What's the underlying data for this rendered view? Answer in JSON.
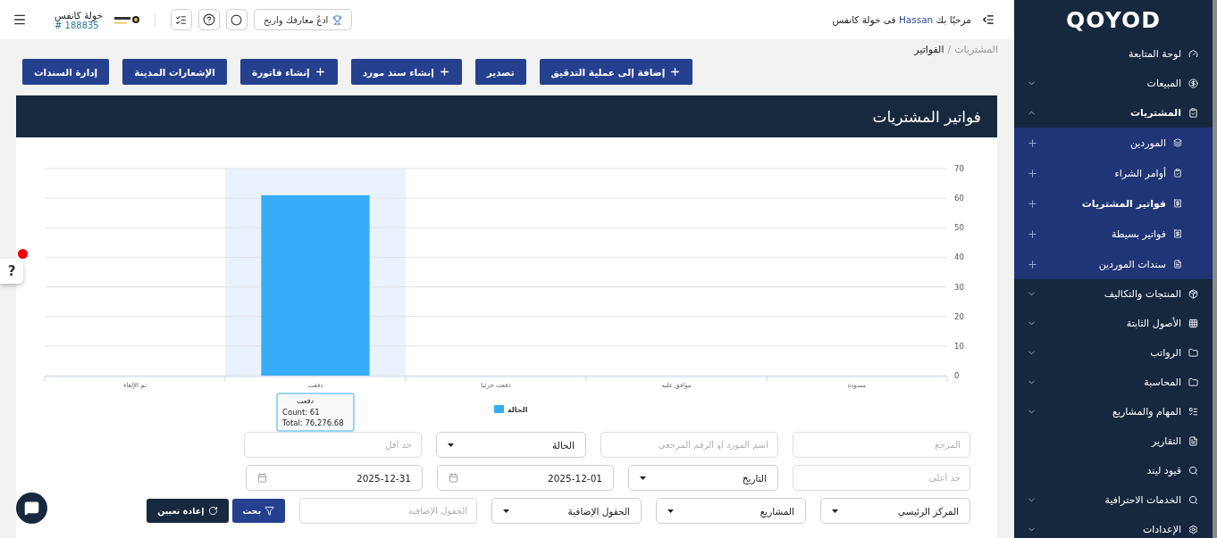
{
  "topbar": {
    "greeting": {
      "prefix": "مرحبًا بك",
      "name": "Hassan",
      "suffix": "فى خولة كانفس"
    },
    "invite": "ادعُ معارفك واربح",
    "company": {
      "name": "خولة كانفس",
      "number": "# 188835"
    }
  },
  "breadcrumb": {
    "separator": "/",
    "items": [
      {
        "label": "المشتريات",
        "current": false
      },
      {
        "label": "الفواتير",
        "current": true
      }
    ]
  },
  "actions": [
    {
      "label": "إضافة إلى عملية التدقيق",
      "kind": "add"
    },
    {
      "label": "تصدير",
      "kind": "plain"
    },
    {
      "label": "إنشاء سند مورد",
      "kind": "add"
    },
    {
      "label": "إنشاء فاتورة",
      "kind": "add"
    },
    {
      "label": "الإشعارات المدينة",
      "kind": "plain"
    },
    {
      "label": "إدارة السندات",
      "kind": "plain"
    }
  ],
  "card": {
    "title": "فواتير المشتريات",
    "chart_data": {
      "type": "bar",
      "categories": [
        "تم الإلغاء",
        "دفعت",
        "دفعت جزئيا",
        "موافق عليه",
        "مسودة"
      ],
      "series": [
        {
          "name": "الحالة",
          "color": "#36adf6",
          "values": [
            0,
            61,
            0,
            0,
            0
          ]
        }
      ],
      "ylim": [
        0,
        70
      ],
      "yticks": [
        0,
        10,
        20,
        30,
        40,
        50,
        60,
        70
      ],
      "grid": true
    },
    "tooltip": {
      "title": "دفعت",
      "lines": [
        "Count: 61",
        "Total: 76,276.68"
      ]
    }
  },
  "filters": {
    "rows": [
      {
        "fields": [
          {
            "kind": "text",
            "placeholder": "المرجع"
          },
          {
            "kind": "text",
            "placeholder": "اسم المورد او الرقم المرجعي"
          },
          {
            "kind": "select",
            "value": "الحالة"
          },
          {
            "kind": "text",
            "placeholder": "حد أقل"
          }
        ]
      },
      {
        "fields": [
          {
            "kind": "text",
            "placeholder": "حد أعلى"
          },
          {
            "kind": "select",
            "value": "التاريخ"
          },
          {
            "kind": "date",
            "value": "2025-12-01"
          },
          {
            "kind": "date",
            "value": "2025-12-31"
          }
        ]
      },
      {
        "fields": [
          {
            "kind": "select",
            "value": "المركز الرئيسي"
          },
          {
            "kind": "select",
            "value": "المشاريع"
          },
          {
            "kind": "select",
            "value": "الحقول الإضافية"
          },
          {
            "kind": "text",
            "placeholder": "الحقول الإضافية"
          }
        ]
      }
    ],
    "search_button": "بحث",
    "reset_button": "إعادة تعيين"
  },
  "help_tab": "?",
  "sidebar": {
    "logo": "QOYOD",
    "items": [
      {
        "label": "لوحة المتابعة",
        "kind": "link",
        "selected": false
      },
      {
        "label": "المبيعات",
        "kind": "group",
        "selected": false,
        "expanded": false
      },
      {
        "label": "المشتريات",
        "kind": "group",
        "selected": false,
        "expanded": true,
        "children": [
          {
            "label": "الموردين",
            "selected": false
          },
          {
            "label": "أوامر الشراء",
            "selected": false
          },
          {
            "label": "فواتير المشتريات",
            "selected": true
          },
          {
            "label": "فواتير بسيطة",
            "selected": false
          },
          {
            "label": "سندات الموردين",
            "selected": false
          }
        ]
      },
      {
        "label": "المنتجات والتكاليف",
        "kind": "group",
        "selected": false,
        "expanded": false
      },
      {
        "label": "الأصول الثابتة",
        "kind": "group",
        "selected": false,
        "expanded": false
      },
      {
        "label": "الرواتب",
        "kind": "group",
        "selected": false,
        "expanded": false
      },
      {
        "label": "المحاسبة",
        "kind": "group",
        "selected": false,
        "expanded": false
      },
      {
        "label": "المهام والمشاريع",
        "kind": "group",
        "selected": false,
        "expanded": false
      },
      {
        "label": "التقارير",
        "kind": "link",
        "selected": false
      },
      {
        "label": "قيود ليند",
        "kind": "link",
        "selected": false
      },
      {
        "label": "الخدمات الاحترافية",
        "kind": "group",
        "selected": false,
        "expanded": false
      },
      {
        "label": "الإعدادات",
        "kind": "group",
        "selected": false,
        "expanded": false
      }
    ]
  }
}
